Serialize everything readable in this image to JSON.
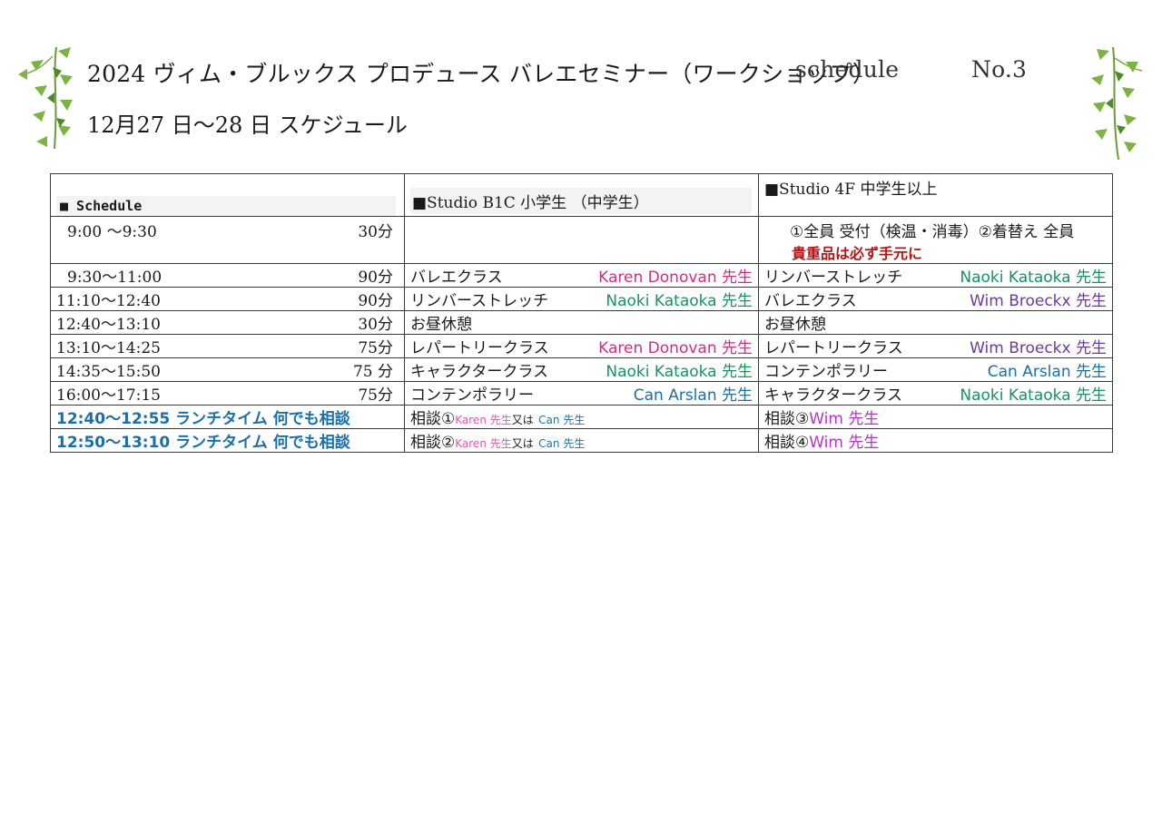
{
  "header": {
    "title": "2024 ヴィム・ブルックス プロデュース バレエセミナー（ワークショップ）",
    "schedule_label": "schedule",
    "number": "No.3",
    "subtitle": "12月27 日～28 日 スケジュール"
  },
  "table": {
    "columns": [
      "■ Schedule",
      "■Studio B1C 小学生 （中学生）",
      "■Studio 4F 中学生以上"
    ],
    "row0": {
      "time": "9:00 ～9:30",
      "duration": "30分",
      "studio4f_line1": "①全員 受付（検温・消毒）②着替え 全員",
      "studio4f_line2": "貴重品は必ず手元に"
    },
    "rows": [
      {
        "time": "9:30～11:00",
        "duration": "90分",
        "b1c_class": "バレエクラス",
        "b1c_teacher": "Karen Donovan 先生",
        "f4_class": "リンバーストレッチ",
        "f4_teacher": "Naoki Kataoka 先生"
      },
      {
        "time": "11:10～12:40",
        "duration": "90分",
        "b1c_class": "リンバーストレッチ",
        "b1c_teacher": "Naoki Kataoka 先生",
        "f4_class": "バレエクラス",
        "f4_teacher": "Wim Broeckx 先生"
      },
      {
        "time": "12:40～13:10",
        "duration": "30分",
        "b1c_class": "お昼休憩",
        "b1c_teacher": "",
        "f4_class": "お昼休憩",
        "f4_teacher": ""
      },
      {
        "time": "13:10～14:25",
        "duration": "75分",
        "b1c_class": "レパートリークラス",
        "b1c_teacher": "Karen Donovan 先生",
        "f4_class": "レパートリークラス",
        "f4_teacher": "Wim Broeckx 先生"
      },
      {
        "time": "14:35～15:50",
        "duration": "75 分",
        "b1c_class": "キャラクタークラス",
        "b1c_teacher": "Naoki Kataoka 先生",
        "f4_class": "コンテンポラリー",
        "f4_teacher": "Can Arslan 先生"
      },
      {
        "time": "16:00～17:15",
        "duration": "75分",
        "b1c_class": "コンテンポラリー",
        "b1c_teacher": "Can Arslan 先生",
        "f4_class": "キャラクタークラス",
        "f4_teacher": "Naoki Kataoka 先生"
      }
    ],
    "consult": [
      {
        "time": "12:40～12:55 ランチタイム 何でも相談",
        "b1c_label": "相談①",
        "b1c_t1": "Karen 先生",
        "b1c_or": "又は",
        "b1c_t2": "Can 先生",
        "f4_label": "相談③",
        "f4_teacher": "Wim 先生"
      },
      {
        "time": "12:50～13:10 ランチタイム 何でも相談",
        "b1c_label": "相談②",
        "b1c_t1": "Karen 先生",
        "b1c_or": "又は",
        "b1c_t2": "Can 先生",
        "f4_label": "相談④",
        "f4_teacher": "Wim 先生"
      }
    ]
  },
  "colors": {
    "karen": "#cc2f86",
    "naoki": "#16945e",
    "wim": "#6d3a9c",
    "can": "#1b6fa1",
    "lunch": "#1c6fa6",
    "warning": "#b01818"
  },
  "decorations": [
    "ivy-left-icon",
    "ivy-right-icon"
  ]
}
